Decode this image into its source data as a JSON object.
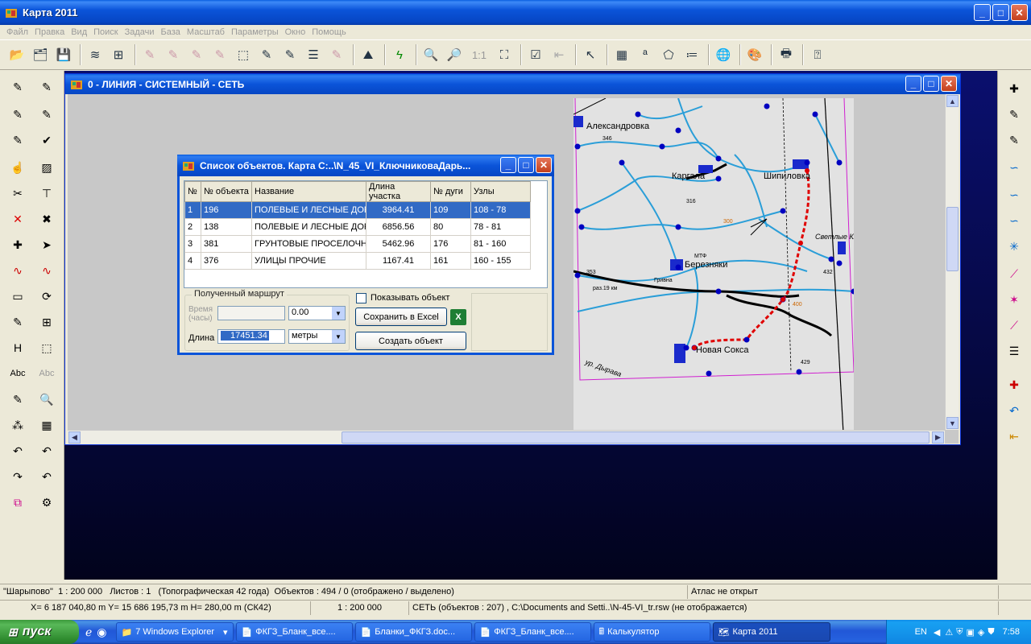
{
  "app": {
    "title": "Карта 2011"
  },
  "menu": [
    "Файл",
    "Правка",
    "Вид",
    "Поиск",
    "Задачи",
    "База",
    "Масштаб",
    "Параметры",
    "Окно",
    "Помощь"
  ],
  "toolbar": {
    "zoom_label": "1:1"
  },
  "left_palette": {
    "text_tool_1": "Abc",
    "text_tool_2": "Abc",
    "h_tool": "H"
  },
  "child_window": {
    "title": "0 - ЛИНИЯ - СИСТЕМНЫЙ - СЕТЬ"
  },
  "map_labels": [
    "Александровка",
    "Каргала",
    "Шипиловка",
    "Березняки",
    "Новая Сокса",
    "Светлые Ключи",
    "ур. Дырава",
    "Гривна",
    "раз.19 км",
    "МТФ",
    "346",
    "316",
    "300",
    "353",
    "432",
    "400",
    "429"
  ],
  "dialog": {
    "title": "Список объектов. Карта С:..\\N_45_VI_КлючниковаДарь...",
    "columns": [
      "№",
      "№ объекта",
      "Название",
      "Длина участка",
      "№ дуги",
      "Узлы"
    ],
    "rows": [
      {
        "n": "1",
        "obj": "196",
        "name": "ПОЛЕВЫЕ И ЛЕСНЫЕ ДОРОГИ",
        "len": "3964.41",
        "arc": "109",
        "nodes": "108 - 78"
      },
      {
        "n": "2",
        "obj": "138",
        "name": "ПОЛЕВЫЕ И ЛЕСНЫЕ ДОРОГИ",
        "len": "6856.56",
        "arc": "80",
        "nodes": "78 - 81"
      },
      {
        "n": "3",
        "obj": "381",
        "name": "ГРУНТОВЫЕ ПРОСЕЛОЧНЫЕ",
        "len": "5462.96",
        "arc": "176",
        "nodes": "81 - 160"
      },
      {
        "n": "4",
        "obj": "376",
        "name": "УЛИЦЫ ПРОЧИЕ",
        "len": "1167.41",
        "arc": "161",
        "nodes": "160 - 155"
      }
    ],
    "route_group": "Полученный маршрут",
    "time_label": "Время (часы)",
    "time_value": "0.00",
    "length_label": "Длина",
    "length_value": "17451.34",
    "length_unit": "метры",
    "show_object_label": "Показывать объект",
    "save_excel": "Сохранить в Excel",
    "create_object": "Создать объект"
  },
  "status": {
    "line1": {
      "map_name": "\"Шарыпово\"",
      "scale": "1 : 200 000",
      "sheets": "Листов : 1",
      "map_type": "(Топографическая 42 года)",
      "objects": "Объектов : 494 / 0 (отображено / выделено)",
      "atlas": "Атлас не открыт"
    },
    "line2": {
      "coords": "X= 6 187 040,80 m  Y= 15 686 195,73 m  H=  280,00 m  (СК42)",
      "scale": "1 : 200 000",
      "layer": "СЕТЬ   (объектов : 207) , C:\\Documents and Setti..\\N-45-VI_tr.rsw (не отображается)"
    }
  },
  "taskbar": {
    "start": "пуск",
    "tasks": [
      "7 Windows Explorer",
      "ФКГЗ_Бланк_все....",
      "Бланки_ФКГЗ.doc...",
      "ФКГЗ_Бланк_все....",
      "Калькулятор",
      "Карта 2011"
    ],
    "lang": "EN",
    "clock": "7:58"
  },
  "colors": {
    "xp_blue": "#0a54d9",
    "selection": "#316ac5",
    "route_red": "#e00000",
    "river_blue": "#2a9ed8",
    "node_blue": "#0000c0",
    "frame_magenta": "#d020d0"
  }
}
